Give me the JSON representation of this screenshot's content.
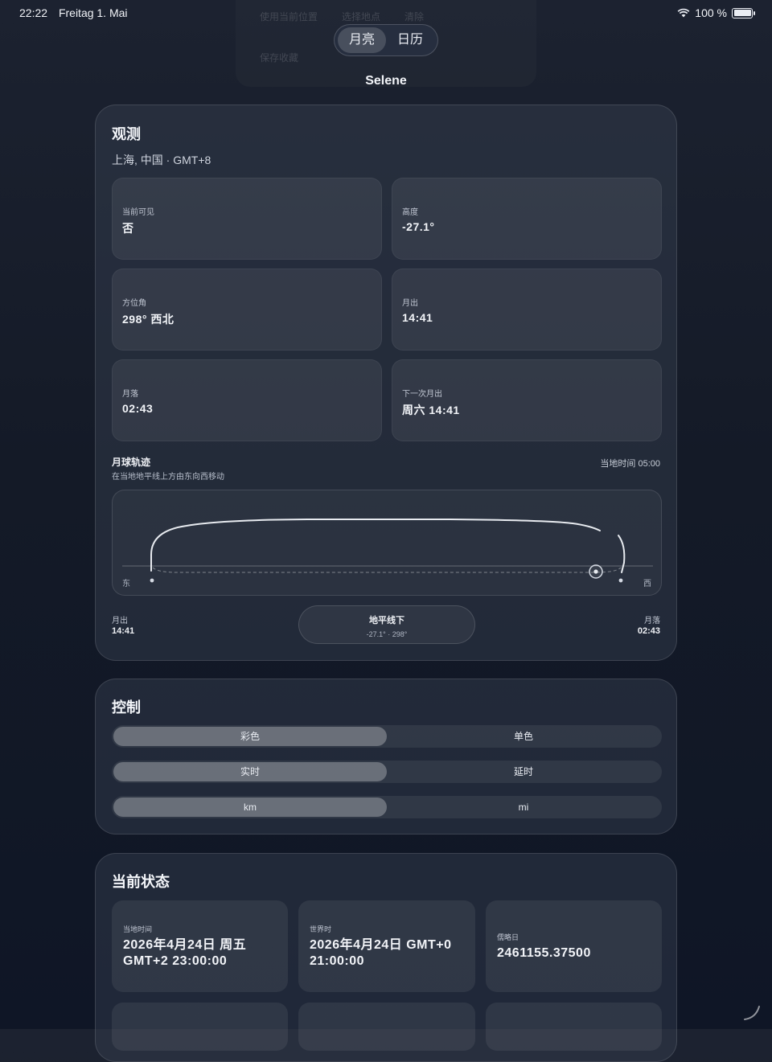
{
  "status_bar": {
    "time": "22:22",
    "date": "Freitag 1. Mai",
    "battery": "100 %"
  },
  "ghost_menu": {
    "items": [
      "使用当前位置",
      "选择地点",
      "清除",
      "保存收藏"
    ]
  },
  "top_tabs": [
    {
      "label": "月亮",
      "active": true
    },
    {
      "label": "日历",
      "active": false
    }
  ],
  "app_title": "Selene",
  "observation": {
    "title": "观测",
    "location": "上海, 中国 · GMT+8",
    "tiles": [
      {
        "label": "当前可见",
        "value": "否"
      },
      {
        "label": "高度",
        "value": "-27.1°"
      },
      {
        "label": "方位角",
        "value": "298° 西北"
      },
      {
        "label": "月出",
        "value": "14:41"
      },
      {
        "label": "月落",
        "value": "02:43"
      },
      {
        "label": "下一次月出",
        "value": "周六 14:41"
      }
    ],
    "track": {
      "title": "月球轨迹",
      "subtitle": "在当地地平线上方由东向西移动",
      "local_time": "当地时间 05:00",
      "east": "东",
      "west": "西"
    },
    "moonrise": {
      "label": "月出",
      "value": "14:41"
    },
    "moonset": {
      "label": "月落",
      "value": "02:43"
    },
    "horizon": {
      "title": "地平线下",
      "detail": "-27.1° · 298°"
    }
  },
  "controls": {
    "title": "控制",
    "toggles": [
      {
        "options": [
          "彩色",
          "单色"
        ],
        "selected": 0
      },
      {
        "options": [
          "实时",
          "延时"
        ],
        "selected": 0
      },
      {
        "options": [
          "km",
          "mi"
        ],
        "selected": 0
      }
    ]
  },
  "status": {
    "title": "当前状态",
    "tiles": [
      {
        "label": "当地时间",
        "line1": "2026年4月24日 周五",
        "line2": "GMT+2 23:00:00"
      },
      {
        "label": "世界时",
        "line1": "2026年4月24日 GMT+0",
        "line2": "21:00:00"
      },
      {
        "label": "儒略日",
        "line1": "2461155.37500"
      }
    ]
  },
  "colors": {
    "background_top": "#1c2230",
    "background_bottom": "#0f1626",
    "accent_track": "#e8ebf0"
  }
}
